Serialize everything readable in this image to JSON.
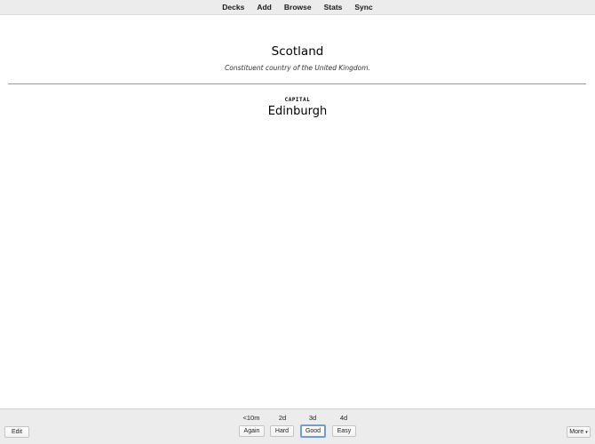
{
  "toolbar": {
    "items": [
      "Decks",
      "Add",
      "Browse",
      "Stats",
      "Sync"
    ]
  },
  "card": {
    "front_title": "Scotland",
    "front_subtitle": "Constituent country of the United Kingdom.",
    "answer_label": "CAPITAL",
    "answer_value": "Edinburgh"
  },
  "bottom_bar": {
    "edit_label": "Edit",
    "more_label": "More",
    "more_caret": "▾",
    "answers": [
      {
        "label": "Again",
        "interval": "<10m"
      },
      {
        "label": "Hard",
        "interval": "2d"
      },
      {
        "label": "Good",
        "interval": "3d"
      },
      {
        "label": "Easy",
        "interval": "4d"
      }
    ],
    "selected_answer": "Good"
  },
  "colors": {
    "toolbar_bg": "#ececec",
    "bottom_bar_bg": "#ececec",
    "focus_ring": "#6f9ed6",
    "divider": "#9a9a9a"
  }
}
